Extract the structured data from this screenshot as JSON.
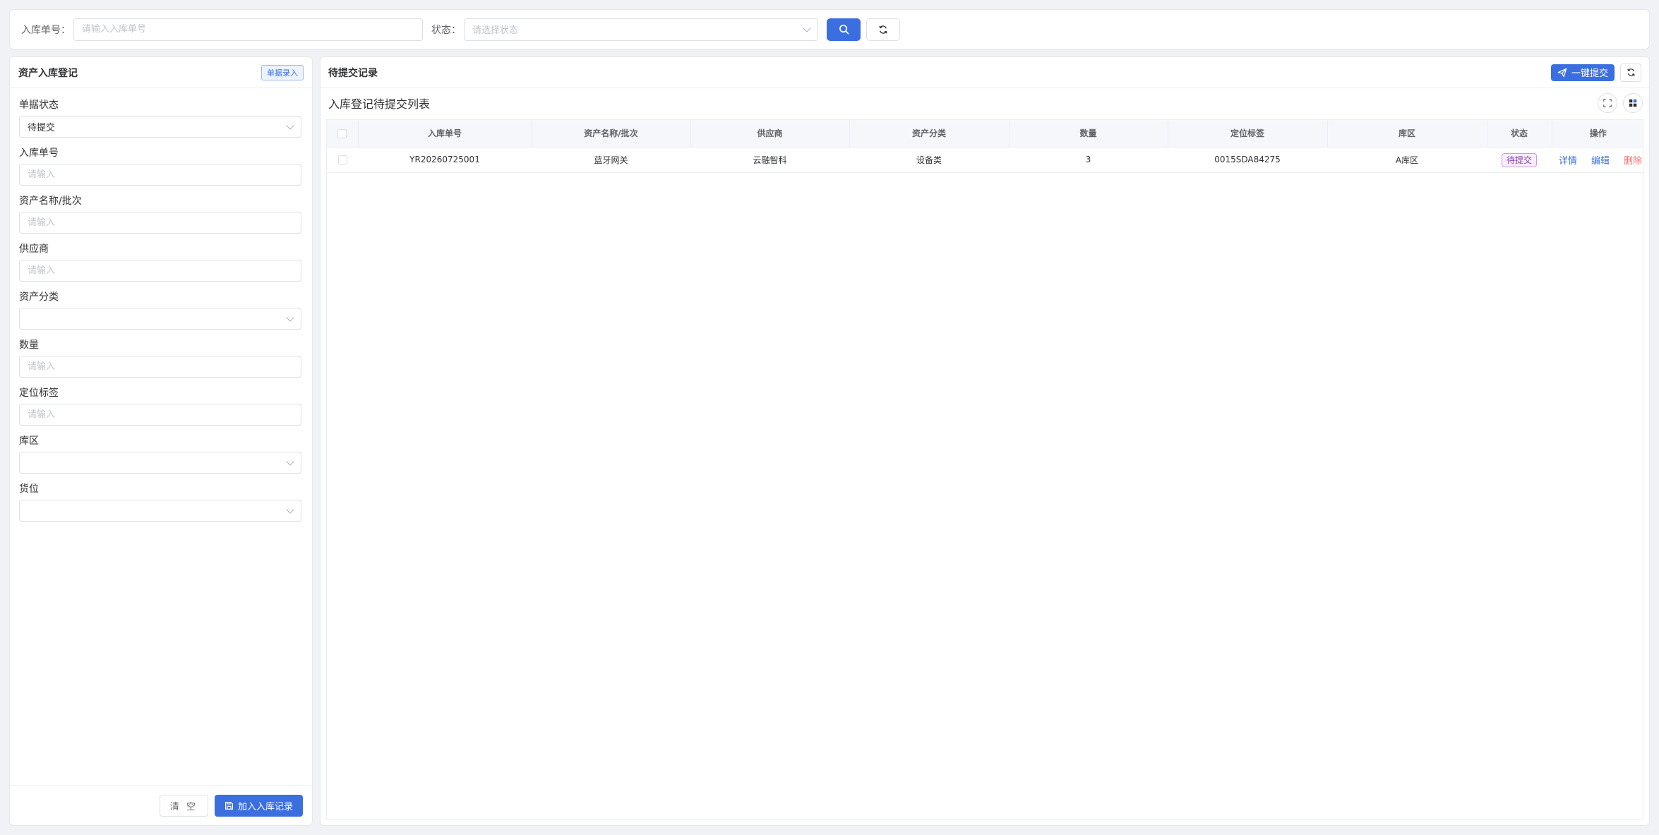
{
  "search": {
    "order_label": "入库单号：",
    "order_placeholder": "请输入入库单号",
    "status_label": "状态：",
    "status_placeholder": "请选择状态",
    "search_icon": "search-icon",
    "refresh_icon": "refresh-icon"
  },
  "left_panel": {
    "title": "资产入库登记",
    "tag": "单据录入",
    "fields": {
      "doc_status": {
        "label": "单据状态",
        "value": "待提交"
      },
      "order_no": {
        "label": "入库单号",
        "placeholder": "请输入"
      },
      "asset_name": {
        "label": "资产名称/批次",
        "placeholder": "请输入"
      },
      "supplier": {
        "label": "供应商",
        "placeholder": "请输入"
      },
      "category": {
        "label": "资产分类",
        "value": ""
      },
      "quantity": {
        "label": "数量",
        "placeholder": "请输入"
      },
      "location_tag": {
        "label": "定位标签",
        "placeholder": "请输入"
      },
      "zone": {
        "label": "库区",
        "value": ""
      },
      "slot": {
        "label": "货位",
        "value": ""
      }
    },
    "clear_label": "清 空",
    "add_label": "加入入库记录"
  },
  "right_panel": {
    "title": "待提交记录",
    "submit_label": "一键提交",
    "list_title": "入库登记待提交列表",
    "columns": [
      "入库单号",
      "资产名称/批次",
      "供应商",
      "资产分类",
      "数量",
      "定位标签",
      "库区",
      "状态",
      "操作"
    ],
    "rows": [
      {
        "order_no": "YR20260725001",
        "asset_name": "蓝牙网关",
        "supplier": "云融智科",
        "category": "设备类",
        "quantity": "3",
        "location_tag": "0015SDA84275",
        "zone": "A库区",
        "status": "待提交",
        "actions": {
          "detail": "详情",
          "edit": "编辑",
          "delete": "删除"
        }
      }
    ]
  },
  "colors": {
    "primary": "#3b6fe0",
    "danger": "#f56c6c",
    "status_purple": "#8e44ad",
    "background": "#f0f2f5"
  }
}
